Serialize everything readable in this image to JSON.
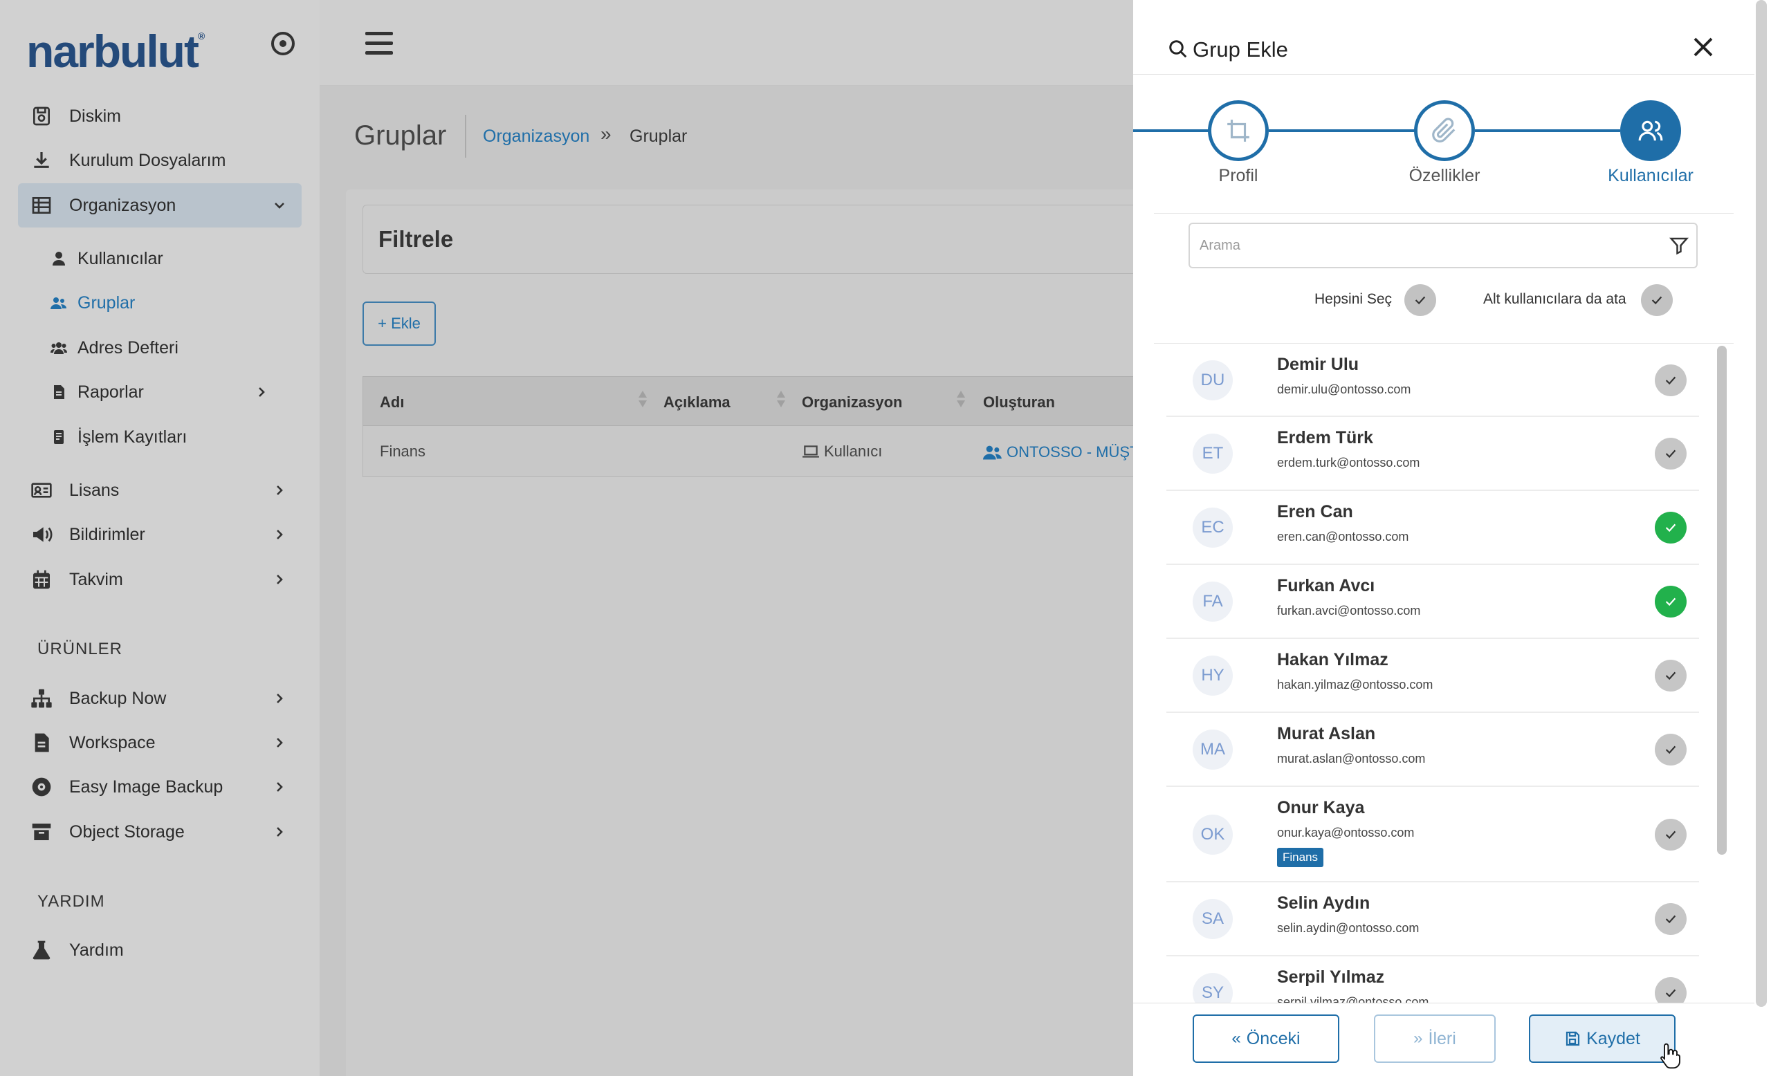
{
  "app": {
    "logo": "narbulut",
    "logo_mark": "®"
  },
  "sidebar": {
    "items": [
      {
        "label": "Diskim",
        "icon": "disk-icon"
      },
      {
        "label": "Kurulum Dosyalarım",
        "icon": "download-icon"
      },
      {
        "label": "Organizasyon",
        "icon": "table-icon",
        "expanded": true
      }
    ],
    "org_sub": [
      {
        "label": "Kullanıcılar",
        "icon": "user-icon"
      },
      {
        "label": "Gruplar",
        "icon": "users-icon"
      },
      {
        "label": "Adres Defteri",
        "icon": "contacts-icon"
      },
      {
        "label": "Raporlar",
        "icon": "report-icon"
      },
      {
        "label": "İşlem Kayıtları",
        "icon": "log-icon"
      }
    ],
    "more": [
      {
        "label": "Lisans",
        "icon": "license-icon"
      },
      {
        "label": "Bildirimler",
        "icon": "megaphone-icon"
      },
      {
        "label": "Takvim",
        "icon": "calendar-icon"
      }
    ],
    "products_title": "ÜRÜNLER",
    "products": [
      {
        "label": "Backup Now",
        "icon": "sitemap-icon"
      },
      {
        "label": "Workspace",
        "icon": "file-icon"
      },
      {
        "label": "Easy Image Backup",
        "icon": "disc-icon"
      },
      {
        "label": "Object Storage",
        "icon": "archive-icon"
      }
    ],
    "help_title": "YARDIM",
    "help": [
      {
        "label": "Yardım",
        "icon": "flask-icon"
      }
    ]
  },
  "main": {
    "title": "Gruplar",
    "breadcrumb": {
      "link": "Organizasyon",
      "sep": "»",
      "current": "Gruplar"
    },
    "filter_label": "Filtrele",
    "add_button": "+ Ekle",
    "table": {
      "headers": [
        "Adı",
        "Açıklama",
        "Organizasyon",
        "Oluşturan"
      ],
      "rows": [
        {
          "name": "Finans",
          "org": "Kullanıcı",
          "creator": "ONTOSSO - MÜŞTE"
        }
      ]
    }
  },
  "drawer": {
    "title": "Grup Ekle",
    "steps": [
      {
        "label": "Profil",
        "icon": "crop-icon"
      },
      {
        "label": "Özellikler",
        "icon": "paperclip-icon"
      },
      {
        "label": "Kullanıcılar",
        "icon": "users-icon",
        "active": true
      }
    ],
    "search_placeholder": "Arama",
    "select_all": "Hepsini Seç",
    "assign_sub": "Alt kullanıcılara da ata",
    "users": [
      {
        "initials": "DU",
        "name": "Demir Ulu",
        "email": "demir.ulu@ontosso.com",
        "checked": false
      },
      {
        "initials": "ET",
        "name": "Erdem Türk",
        "email": "erdem.turk@ontosso.com",
        "checked": false
      },
      {
        "initials": "EC",
        "name": "Eren Can",
        "email": "eren.can@ontosso.com",
        "checked": true
      },
      {
        "initials": "FA",
        "name": "Furkan Avcı",
        "email": "furkan.avci@ontosso.com",
        "checked": true
      },
      {
        "initials": "HY",
        "name": "Hakan Yılmaz",
        "email": "hakan.yilmaz@ontosso.com",
        "checked": false
      },
      {
        "initials": "MA",
        "name": "Murat Aslan",
        "email": "murat.aslan@ontosso.com",
        "checked": false
      },
      {
        "initials": "OK",
        "name": "Onur Kaya",
        "email": "onur.kaya@ontosso.com",
        "checked": false,
        "tag": "Finans"
      },
      {
        "initials": "SA",
        "name": "Selin Aydın",
        "email": "selin.aydin@ontosso.com",
        "checked": false
      },
      {
        "initials": "SY",
        "name": "Serpil Yılmaz",
        "email": "serpil.yilmaz@ontosso.com",
        "checked": false
      }
    ],
    "buttons": {
      "prev": "Önceki",
      "next": "İleri",
      "save": "Kaydet"
    }
  },
  "colors": {
    "brand": "#1f6ea8",
    "checked": "#22b14c",
    "logo": "#244a7a"
  }
}
